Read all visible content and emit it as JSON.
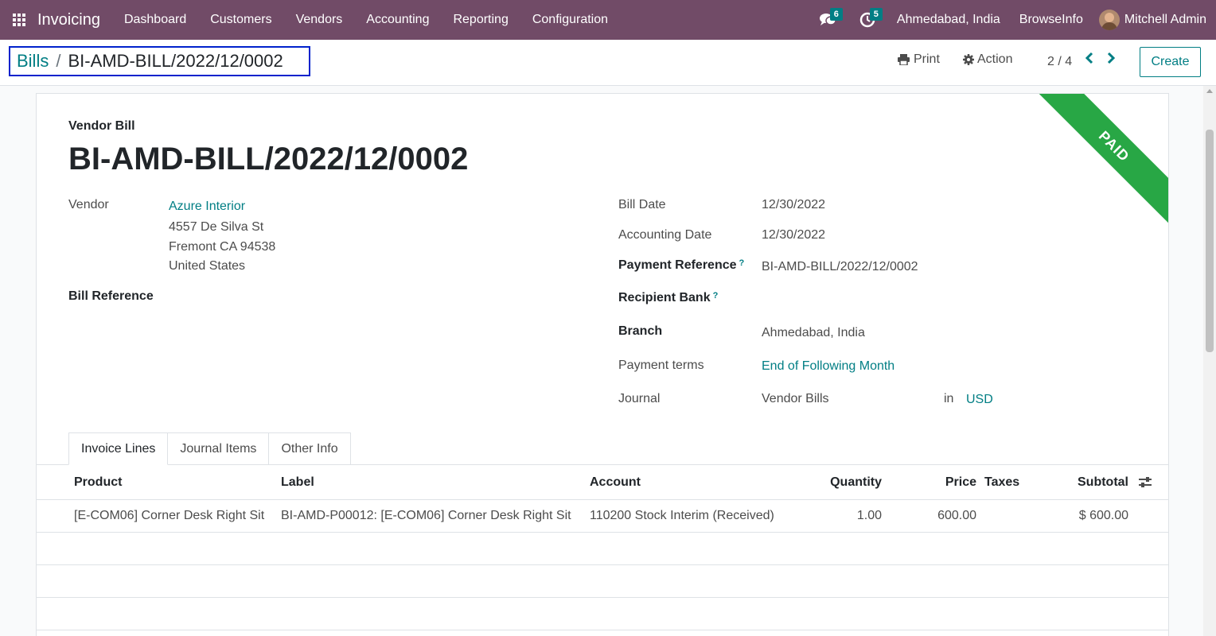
{
  "navbar": {
    "app_name": "Invoicing",
    "menu": [
      "Dashboard",
      "Customers",
      "Vendors",
      "Accounting",
      "Reporting",
      "Configuration"
    ],
    "messages_count": "6",
    "activities_count": "5",
    "branch": "Ahmedabad, India",
    "company": "BrowseInfo",
    "user": "Mitchell Admin"
  },
  "control_panel": {
    "breadcrumb_parent": "Bills",
    "breadcrumb_separator": "/",
    "breadcrumb_current": "BI-AMD-BILL/2022/12/0002",
    "print_label": "Print",
    "action_label": "Action",
    "pager": "2 / 4",
    "create_label": "Create"
  },
  "form": {
    "status_ribbon": "PAID",
    "doc_type": "Vendor Bill",
    "doc_name": "BI-AMD-BILL/2022/12/0002",
    "vendor_label": "Vendor",
    "vendor_name": "Azure Interior",
    "vendor_address": [
      "4557 De Silva St",
      "Fremont CA 94538",
      "United States"
    ],
    "bill_reference_label": "Bill Reference",
    "bill_date_label": "Bill Date",
    "bill_date": "12/30/2022",
    "accounting_date_label": "Accounting Date",
    "accounting_date": "12/30/2022",
    "payment_reference_label": "Payment Reference",
    "payment_reference": "BI-AMD-BILL/2022/12/0002",
    "recipient_bank_label": "Recipient Bank",
    "help_mark": "?",
    "branch_label": "Branch",
    "branch": "Ahmedabad, India",
    "payment_terms_label": "Payment terms",
    "payment_terms": "End of Following Month",
    "journal_label": "Journal",
    "journal": "Vendor Bills",
    "in_label": "in",
    "currency": "USD"
  },
  "tabs": [
    "Invoice Lines",
    "Journal Items",
    "Other Info"
  ],
  "table": {
    "columns": {
      "product": "Product",
      "label": "Label",
      "account": "Account",
      "quantity": "Quantity",
      "price": "Price",
      "taxes": "Taxes",
      "subtotal": "Subtotal"
    },
    "rows": [
      {
        "product": "[E-COM06] Corner Desk Right Sit",
        "label": "BI-AMD-P00012: [E-COM06] Corner Desk Right Sit",
        "account": "110200 Stock Interim (Received)",
        "quantity": "1.00",
        "price": "600.00",
        "taxes": "",
        "subtotal": "$ 600.00"
      }
    ]
  }
}
